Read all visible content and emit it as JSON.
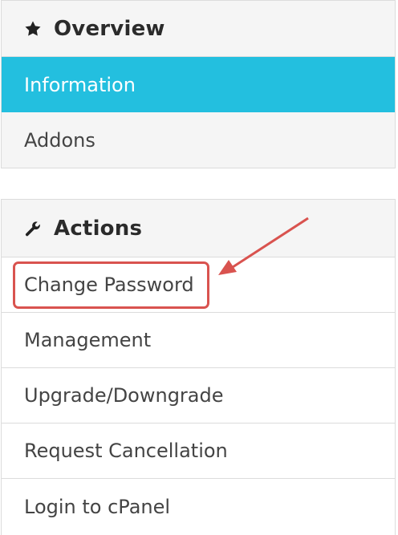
{
  "overview": {
    "title": "Overview",
    "icon": "star-icon",
    "items": [
      {
        "label": "Information",
        "active": true
      },
      {
        "label": "Addons",
        "active": false
      }
    ]
  },
  "actions": {
    "title": "Actions",
    "icon": "wrench-icon",
    "items": [
      {
        "label": "Change Password",
        "highlighted": true
      },
      {
        "label": "Management"
      },
      {
        "label": "Upgrade/Downgrade"
      },
      {
        "label": "Request Cancellation"
      },
      {
        "label": "Login to cPanel"
      }
    ]
  },
  "annotation": {
    "color": "#d9534f",
    "type": "arrow-and-box"
  },
  "colors": {
    "active_bg": "#23bfdf",
    "heading_bg": "#f5f5f5"
  }
}
